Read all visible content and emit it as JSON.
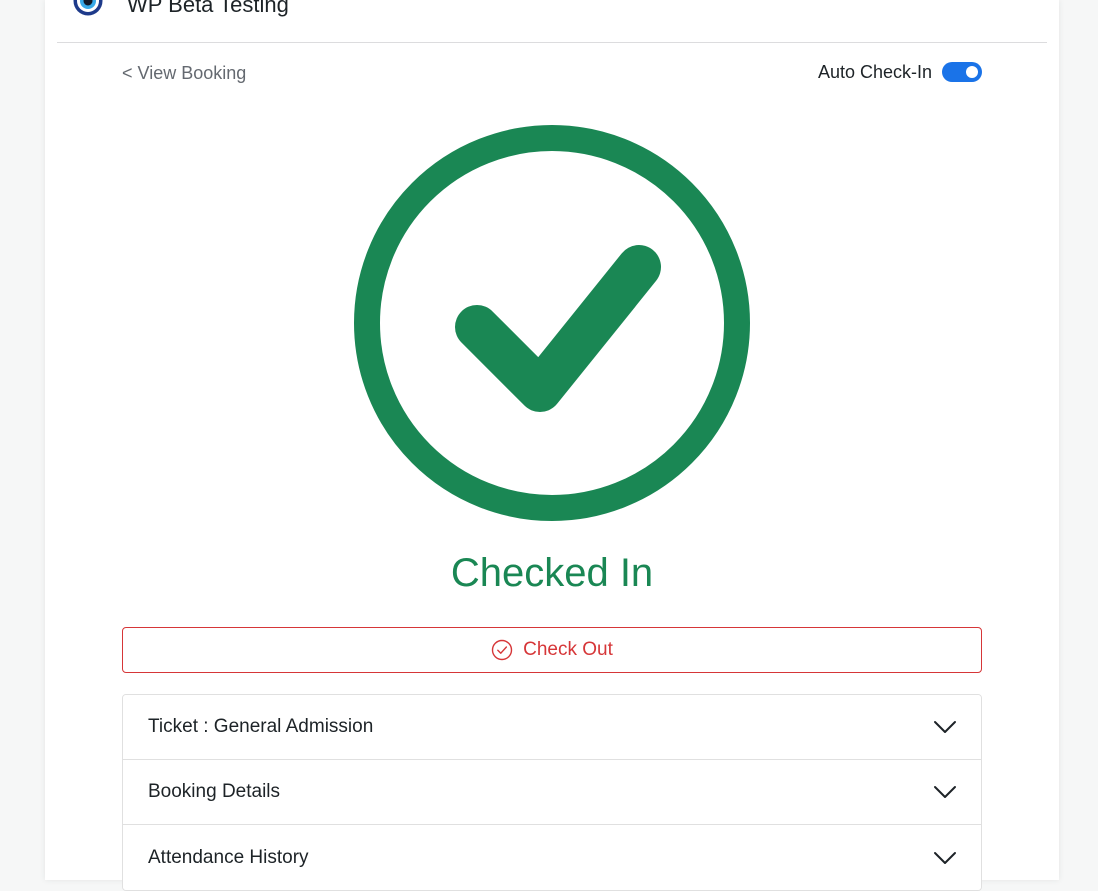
{
  "header": {
    "site_title": "WP Beta Testing",
    "logo_icon": "site-logo-icon"
  },
  "nav": {
    "back_label": "< View Booking"
  },
  "auto_checkin": {
    "label": "Auto Check-In",
    "enabled": true
  },
  "status": {
    "text": "Checked In",
    "icon": "check-circle-icon",
    "color": "#1a8754"
  },
  "checkout": {
    "label": "Check Out",
    "icon": "check-circle-outline-icon",
    "color": "#d63638"
  },
  "accordion": [
    {
      "label": "Ticket : General Admission",
      "icon": "chevron-down-icon"
    },
    {
      "label": "Booking Details",
      "icon": "chevron-down-icon"
    },
    {
      "label": "Attendance History",
      "icon": "chevron-down-icon"
    }
  ],
  "colors": {
    "accent": "#1a73e8",
    "success": "#1a8754",
    "danger": "#d63638"
  }
}
